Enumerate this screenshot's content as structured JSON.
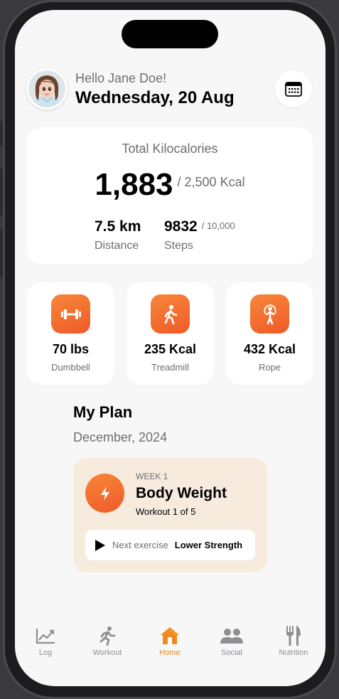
{
  "header": {
    "greeting": "Hello Jane Doe!",
    "date": "Wednesday, 20 Aug"
  },
  "summary": {
    "label": "Total Kilocalories",
    "value": "1,883",
    "goal": "/ 2,500 Kcal",
    "distance": {
      "value": "7.5 km",
      "label": "Distance"
    },
    "steps": {
      "value": "9832",
      "goal": "/ 10,000",
      "label": "Steps"
    }
  },
  "equipment": [
    {
      "value": "70 lbs",
      "label": "Dumbbell",
      "icon": "dumbbell-icon"
    },
    {
      "value": "235 Kcal",
      "label": "Treadmill",
      "icon": "walking-icon"
    },
    {
      "value": "432 Kcal",
      "label": "Rope",
      "icon": "jump-rope-icon"
    }
  ],
  "plan": {
    "title": "My Plan",
    "date": "December, 2024",
    "week": "WEEK 1",
    "name": "Body Weight",
    "progress": "Workout 1 of 5",
    "next_label": "Next exercise",
    "next_value": "Lower Strength"
  },
  "tabs": [
    {
      "label": "Log",
      "icon": "chart-icon"
    },
    {
      "label": "Workout",
      "icon": "running-icon"
    },
    {
      "label": "Home",
      "icon": "home-icon",
      "active": true
    },
    {
      "label": "Social",
      "icon": "people-icon"
    },
    {
      "label": "Nutrition",
      "icon": "fork-knife-icon"
    }
  ],
  "colors": {
    "accent": "#f08a1c",
    "icon_gradient_start": "#f7873a",
    "icon_gradient_end": "#ef5a28",
    "plan_card_bg": "#f6ebdd",
    "background": "#f7f7f7"
  }
}
